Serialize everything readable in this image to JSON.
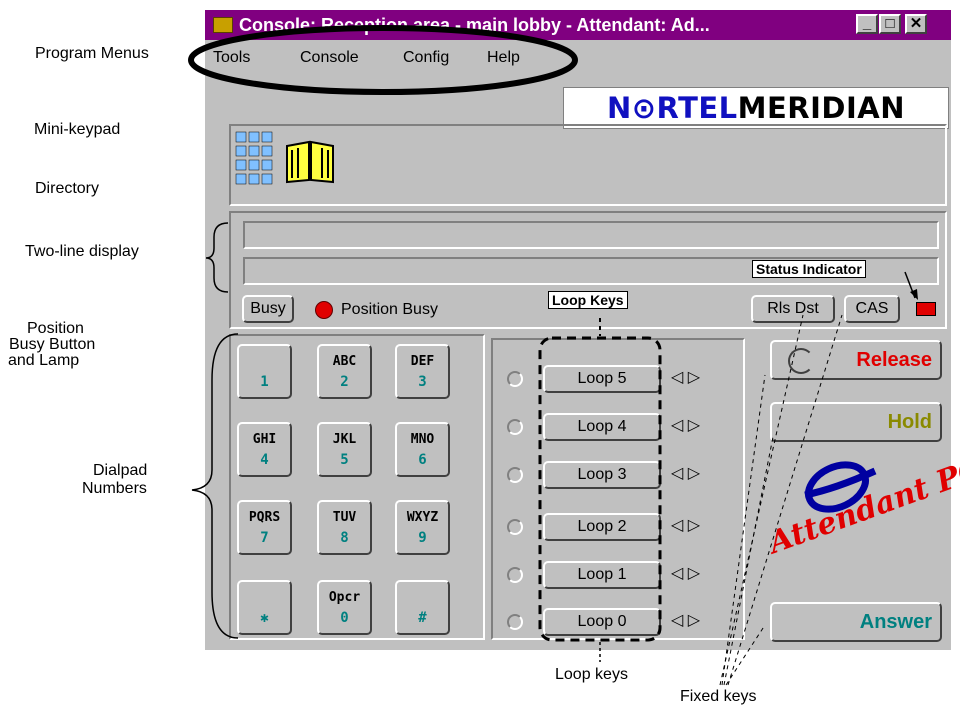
{
  "window": {
    "title": "Console: Reception area - main lobby - Attendant: Ad...",
    "minimize_glyph": "_",
    "maximize_glyph": "□",
    "close_glyph": "✕"
  },
  "menu": [
    {
      "label": "Tools"
    },
    {
      "label": "Console"
    },
    {
      "label": "Config"
    },
    {
      "label": "Help"
    }
  ],
  "brand": {
    "part1": "N⊙RTEL",
    "part2": "MERIDIAN",
    "color1": "#1010c0"
  },
  "icons": {
    "mini_keypad": "mini-keypad-icon",
    "directory": "directory-book-icon"
  },
  "position_busy": {
    "button_label": "Busy",
    "lamp_label": "Position Busy",
    "lamp_color": "#e00000"
  },
  "status": {
    "rls_dst_label": "Rls Dst",
    "cas_label": "CAS",
    "indicator_color": "#e00000"
  },
  "dialpad": [
    {
      "letters": "",
      "digit": "1"
    },
    {
      "letters": "ABC",
      "digit": "2"
    },
    {
      "letters": "DEF",
      "digit": "3"
    },
    {
      "letters": "GHI",
      "digit": "4"
    },
    {
      "letters": "JKL",
      "digit": "5"
    },
    {
      "letters": "MNO",
      "digit": "6"
    },
    {
      "letters": "PQRS",
      "digit": "7"
    },
    {
      "letters": "TUV",
      "digit": "8"
    },
    {
      "letters": "WXYZ",
      "digit": "9"
    },
    {
      "letters": "",
      "digit": "✱"
    },
    {
      "letters": "Opcr",
      "digit": "0"
    },
    {
      "letters": "",
      "digit": "#"
    }
  ],
  "loops": [
    {
      "label": "Loop 5"
    },
    {
      "label": "Loop 4"
    },
    {
      "label": "Loop 3"
    },
    {
      "label": "Loop 2"
    },
    {
      "label": "Loop 1"
    },
    {
      "label": "Loop 0"
    }
  ],
  "loop_arrows": "◁ ▷",
  "fixed_keys": {
    "release": {
      "label": "Release",
      "color": "#e00000"
    },
    "hold": {
      "label": "Hold",
      "color": "#8a8a00"
    },
    "answer": {
      "label": "Answer",
      "color": "#008080"
    }
  },
  "logo": {
    "text": "Attendant PC",
    "color": "#e00000",
    "mark_color": "#0000a0"
  },
  "callouts": {
    "program_menus": "Program Menus",
    "mini_keypad": "Mini-keypad",
    "directory": "Directory",
    "two_line_display": "Two-line display",
    "position_busy_1": "Position",
    "position_busy_2": "Busy Button",
    "position_busy_3": "and Lamp",
    "dialpad_1": "Dialpad",
    "dialpad_2": "Numbers",
    "loop_keys_box": "Loop Keys",
    "status_indicator": "Status Indicator",
    "loop_keys_bottom": "Loop keys",
    "fixed_keys": "Fixed keys"
  }
}
